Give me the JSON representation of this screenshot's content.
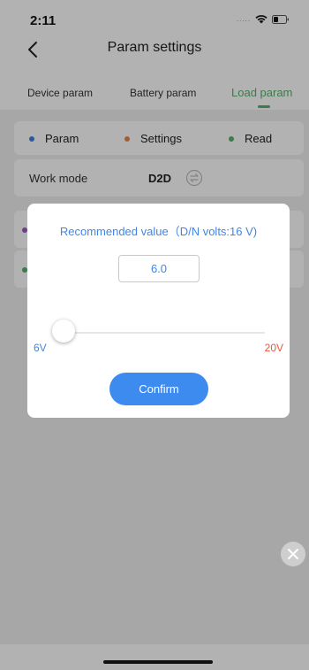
{
  "status_bar": {
    "time": "2:11",
    "signal": "....."
  },
  "nav": {
    "title": "Param settings"
  },
  "tabs": [
    {
      "label": "Device param",
      "active": false
    },
    {
      "label": "Battery param",
      "active": false
    },
    {
      "label": "Load param",
      "active": true
    }
  ],
  "legend": [
    {
      "label": "Param",
      "color": "#3e7fe0"
    },
    {
      "label": "Settings",
      "color": "#e58a4f"
    },
    {
      "label": "Read",
      "color": "#56b26a"
    }
  ],
  "work_mode": {
    "label": "Work mode",
    "value": "D2D"
  },
  "hidden_rows": [
    {
      "dot_color": "#9b59c8"
    },
    {
      "dot_color": "#56b26a"
    }
  ],
  "dialog": {
    "title": "Recommended value（D/N volts:16 V)",
    "input_value": "6.0",
    "slider": {
      "min_label": "6V",
      "max_label": "20V",
      "min": 6,
      "max": 20,
      "value": 6.0
    },
    "confirm_label": "Confirm"
  },
  "colors": {
    "accent_green": "#56b26a",
    "accent_blue": "#3e86e8",
    "max_red": "#e8583b"
  }
}
